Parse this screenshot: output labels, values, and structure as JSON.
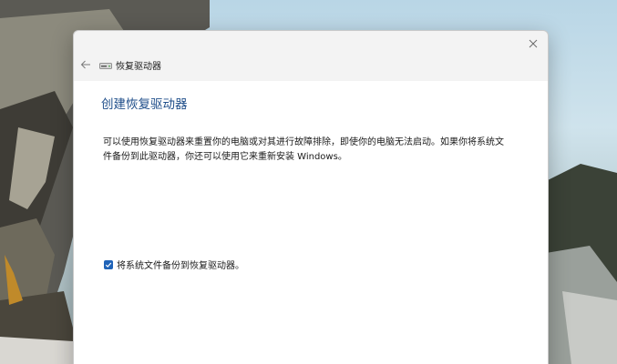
{
  "window": {
    "title": "恢复驱动器",
    "close_label": "×"
  },
  "main": {
    "heading": "创建恢复驱动器",
    "description": "可以使用恢复驱动器来重置你的电脑或对其进行故障排除，即使你的电脑无法启动。如果你将系统文件备份到此驱动器，你还可以使用它来重新安装 Windows。",
    "checkbox": {
      "label": "将系统文件备份到恢复驱动器。",
      "checked": true
    }
  },
  "colors": {
    "heading": "#1f4e8a",
    "checkbox_fill": "#1f63b8"
  },
  "icons": {
    "back": "back-arrow-icon",
    "close": "close-icon",
    "drive": "drive-icon",
    "check": "checkmark-icon"
  }
}
